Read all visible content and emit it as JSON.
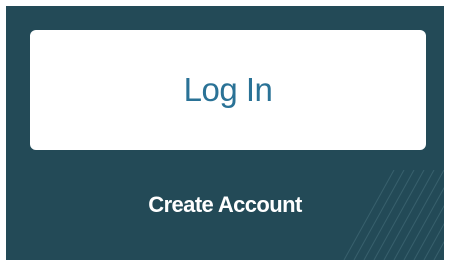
{
  "login": {
    "button_label": "Log In"
  },
  "create_account": {
    "link_label": "Create Account"
  },
  "colors": {
    "panel_background": "#234a57",
    "button_background": "#ffffff",
    "button_text": "#2a7296",
    "link_text": "#ffffff"
  }
}
